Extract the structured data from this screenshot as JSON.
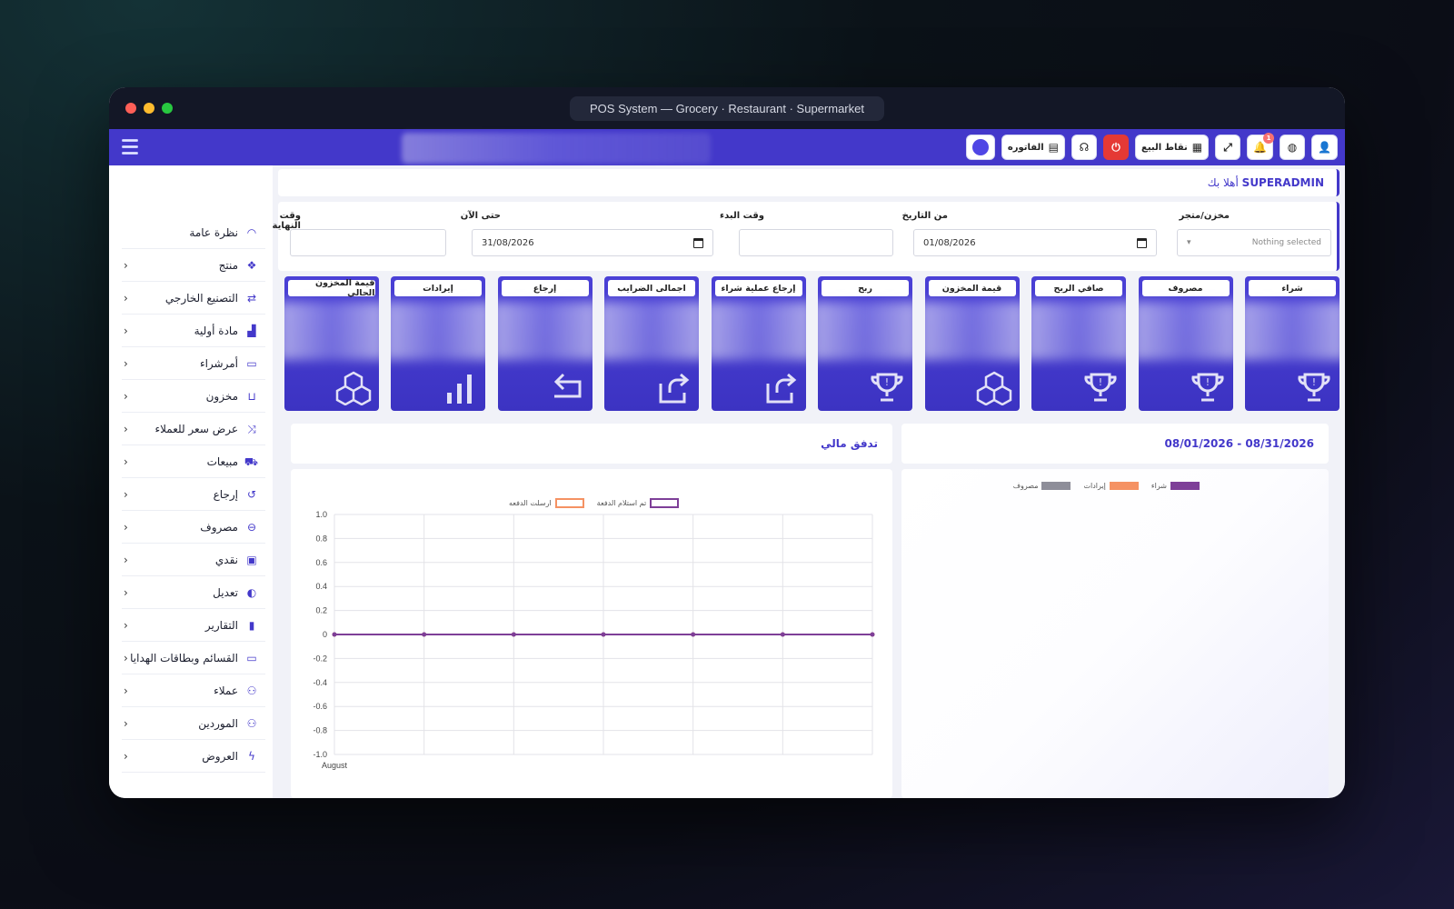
{
  "window": {
    "title": "POS System — Grocery · Restaurant · Supermarket"
  },
  "topbar": {
    "buttons": [
      {
        "name": "user-button",
        "icon": "user-icon",
        "label": ""
      },
      {
        "name": "language-button",
        "icon": "globe-icon",
        "label": ""
      },
      {
        "name": "notifications-button",
        "icon": "bell-icon",
        "label": "",
        "badge": "1"
      },
      {
        "name": "fullscreen-button",
        "icon": "expand-icon",
        "label": ""
      },
      {
        "name": "pos-button",
        "icon": "cash-register-icon",
        "label": "نقاط البيع"
      },
      {
        "name": "logout-button",
        "icon": "power-icon",
        "label": ""
      },
      {
        "name": "support-button",
        "icon": "headset-icon",
        "label": ""
      },
      {
        "name": "invoice-button",
        "icon": "document-icon",
        "label": "الفاتوره"
      },
      {
        "name": "theme-button",
        "icon": "circle-icon",
        "label": ""
      }
    ]
  },
  "sidebar": {
    "items": [
      {
        "label": "نظرة عامة",
        "icon": "dashboard-icon",
        "chevron": false
      },
      {
        "label": "منتج",
        "icon": "cubes-icon",
        "chevron": true
      },
      {
        "label": "التصنيع الخارجي",
        "icon": "exchange-icon",
        "chevron": true
      },
      {
        "label": "مادة أولية",
        "icon": "factory-icon",
        "chevron": true
      },
      {
        "label": "أمرشراء",
        "icon": "card-icon",
        "chevron": true
      },
      {
        "label": "مخزون",
        "icon": "basket-icon",
        "chevron": true
      },
      {
        "label": "عرض سعر للعملاء",
        "icon": "shuffle-icon",
        "chevron": true
      },
      {
        "label": "مبيعات",
        "icon": "cart-icon",
        "chevron": true
      },
      {
        "label": "إرجاع",
        "icon": "undo-icon",
        "chevron": true
      },
      {
        "label": "مصروف",
        "icon": "minus-circle-icon",
        "chevron": true
      },
      {
        "label": "نقدي",
        "icon": "money-icon",
        "chevron": true
      },
      {
        "label": "تعديل",
        "icon": "adjust-icon",
        "chevron": true
      },
      {
        "label": "التقارير",
        "icon": "file-icon",
        "chevron": true
      },
      {
        "label": "القسائم وبطاقات الهدايا",
        "icon": "gift-card-icon",
        "chevron": true
      },
      {
        "label": "عملاء",
        "icon": "users-icon",
        "chevron": true
      },
      {
        "label": "الموردين",
        "icon": "suppliers-icon",
        "chevron": true
      },
      {
        "label": "العروض",
        "icon": "bolt-icon",
        "chevron": true
      }
    ]
  },
  "welcome": {
    "greeting": "أهلا بك",
    "user": "SUPERADMIN"
  },
  "filters": {
    "warehouse_label": "مخزن/متجر",
    "warehouse_placeholder": "Nothing selected",
    "from_date_label": "من التاريخ",
    "from_date_value": "01/08/2026",
    "start_time_label": "وقت البدء",
    "start_time_value": "",
    "to_date_label": "حتى الآن",
    "to_date_value": "31/08/2026",
    "end_time_label": "وقت النهاية",
    "end_time_value": ""
  },
  "cards": [
    {
      "label": "شراء",
      "icon": "trophy-icon"
    },
    {
      "label": "مصروف",
      "icon": "trophy-icon"
    },
    {
      "label": "صافي الربح",
      "icon": "trophy-icon"
    },
    {
      "label": "قيمة المخزون",
      "icon": "cubes-icon"
    },
    {
      "label": "ربح",
      "icon": "trophy-icon"
    },
    {
      "label": "إرجاع عملية شراء",
      "icon": "share-icon"
    },
    {
      "label": "اجمالى الضرايب",
      "icon": "share-icon"
    },
    {
      "label": "إرجاع",
      "icon": "reply-icon"
    },
    {
      "label": "إيرادات",
      "icon": "bar-chart-icon"
    },
    {
      "label": "قيمة المخزون الحالي",
      "icon": "cubes-icon"
    }
  ],
  "summary_panel": {
    "date_range": "08/01/2026 - 08/31/2026",
    "legend": [
      {
        "label": "شراء",
        "color": "#7e3f98"
      },
      {
        "label": "إيرادات",
        "color": "#f59263"
      },
      {
        "label": "مصروف",
        "color": "#8e8e99"
      }
    ]
  },
  "cashflow_panel": {
    "title": "تدفق مالي"
  },
  "chart_data": {
    "type": "line",
    "title": "",
    "xlabel": "",
    "ylabel": "",
    "categories": [
      "August",
      "",
      "",
      "",
      "",
      "",
      ""
    ],
    "series": [
      {
        "name": "تم استلام الدفعة",
        "color": "#7e3f98",
        "values": [
          0,
          0,
          0,
          0,
          0,
          0,
          0
        ]
      },
      {
        "name": "ارسلت الدفعه",
        "color": "#f59263",
        "values": [
          0,
          0,
          0,
          0,
          0,
          0,
          0
        ]
      }
    ],
    "ylim": [
      -1.0,
      1.0
    ],
    "yticks": [
      "1.0",
      "0.8",
      "0.6",
      "0.4",
      "0.2",
      "0",
      "-0.2",
      "-0.4",
      "-0.6",
      "-0.8",
      "-1.0"
    ],
    "grid": true,
    "legend_position": "top"
  }
}
